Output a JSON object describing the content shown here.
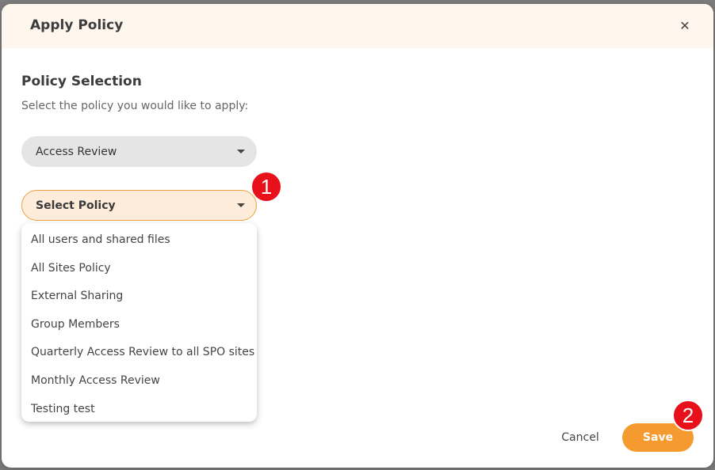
{
  "dialog": {
    "title": "Apply Policy",
    "close_icon": "close-icon",
    "close_glyph": "✕"
  },
  "section": {
    "title": "Policy Selection",
    "subtitle": "Select the policy you would like to apply:"
  },
  "category_select": {
    "value": "Access Review"
  },
  "policy_select": {
    "value": "Select Policy",
    "options": [
      "All users and shared files",
      "All Sites Policy",
      "External Sharing",
      "Group Members",
      "Quarterly Access Review to all SPO sites",
      "Monthly Access Review",
      "Testing test"
    ]
  },
  "annotations": {
    "badge_1": "1",
    "badge_2": "2"
  },
  "footer": {
    "cancel_label": "Cancel",
    "save_label": "Save"
  },
  "colors": {
    "accent": "#f59a2e",
    "header_bg": "#fff7ee",
    "badge": "#e8101a"
  }
}
